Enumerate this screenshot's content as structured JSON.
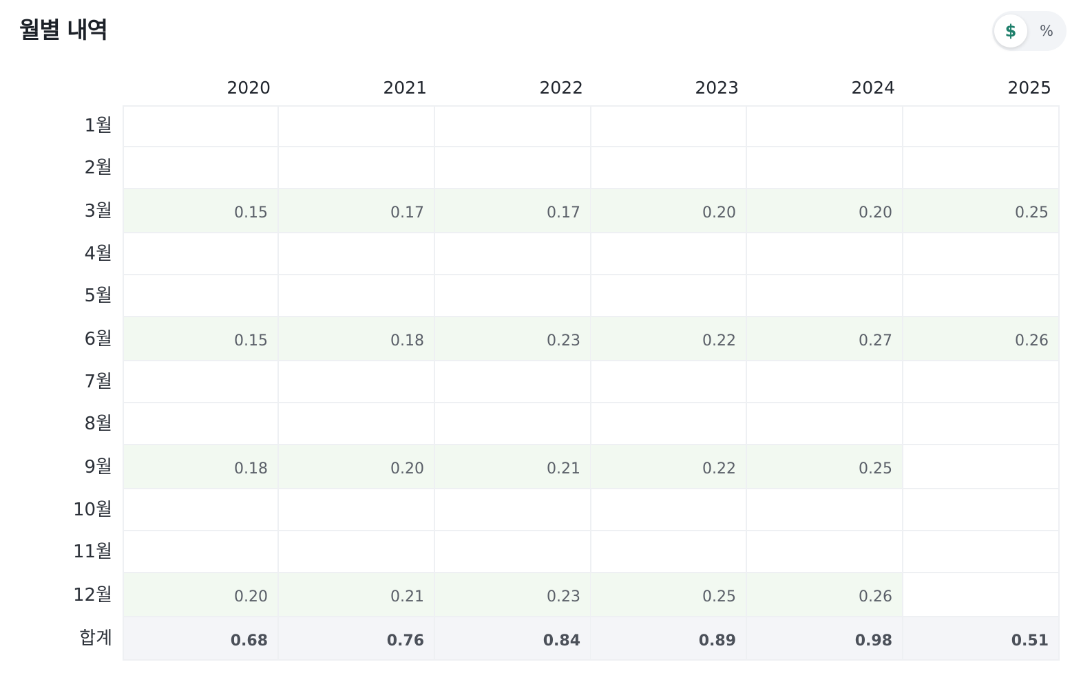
{
  "title": "월별 내역",
  "toggle": {
    "dollar_label": "$",
    "percent_label": "%",
    "selected": "$",
    "accent_color": "#1e7f6b"
  },
  "table": {
    "columns": [
      "2020",
      "2021",
      "2022",
      "2023",
      "2024",
      "2025"
    ],
    "rows": [
      {
        "label": "1월",
        "values": [
          "",
          "",
          "",
          "",
          "",
          ""
        ],
        "highlight": false
      },
      {
        "label": "2월",
        "values": [
          "",
          "",
          "",
          "",
          "",
          ""
        ],
        "highlight": false
      },
      {
        "label": "3월",
        "values": [
          "0.15",
          "0.17",
          "0.17",
          "0.20",
          "0.20",
          "0.25"
        ],
        "highlight": true
      },
      {
        "label": "4월",
        "values": [
          "",
          "",
          "",
          "",
          "",
          ""
        ],
        "highlight": false
      },
      {
        "label": "5월",
        "values": [
          "",
          "",
          "",
          "",
          "",
          ""
        ],
        "highlight": false
      },
      {
        "label": "6월",
        "values": [
          "0.15",
          "0.18",
          "0.23",
          "0.22",
          "0.27",
          "0.26"
        ],
        "highlight": true
      },
      {
        "label": "7월",
        "values": [
          "",
          "",
          "",
          "",
          "",
          ""
        ],
        "highlight": false
      },
      {
        "label": "8월",
        "values": [
          "",
          "",
          "",
          "",
          "",
          ""
        ],
        "highlight": false
      },
      {
        "label": "9월",
        "values": [
          "0.18",
          "0.20",
          "0.21",
          "0.22",
          "0.25",
          ""
        ],
        "highlight": true
      },
      {
        "label": "10월",
        "values": [
          "",
          "",
          "",
          "",
          "",
          ""
        ],
        "highlight": false
      },
      {
        "label": "11월",
        "values": [
          "",
          "",
          "",
          "",
          "",
          ""
        ],
        "highlight": false
      },
      {
        "label": "12월",
        "values": [
          "0.20",
          "0.21",
          "0.23",
          "0.25",
          "0.26",
          ""
        ],
        "highlight": true
      }
    ],
    "total": {
      "label": "합계",
      "values": [
        "0.68",
        "0.76",
        "0.84",
        "0.89",
        "0.98",
        "0.51"
      ]
    },
    "highlight_color": "#f2f9f1",
    "total_color": "#f4f5f8"
  }
}
